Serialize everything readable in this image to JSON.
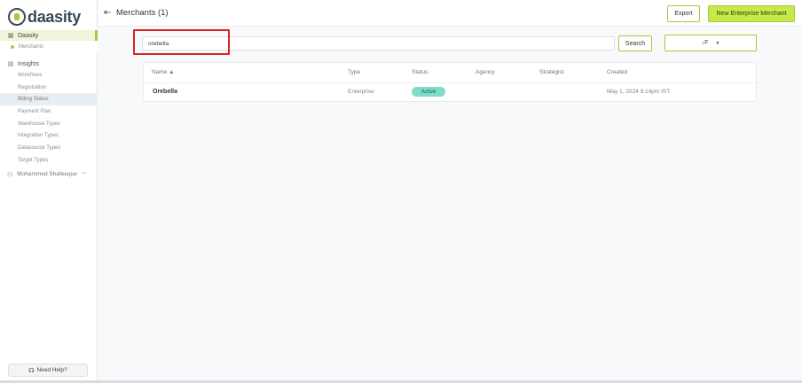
{
  "app": {
    "logo_text": "daasity"
  },
  "sidebar": {
    "daasity_group": {
      "label": "Daasity",
      "items": [
        {
          "label": "Merchants"
        }
      ]
    },
    "insights_group": {
      "label": "Insights",
      "items": [
        {
          "label": "Workflows"
        },
        {
          "label": "Registration"
        },
        {
          "label": "Billing Status"
        },
        {
          "label": "Payment Plan"
        },
        {
          "label": "Warehouse Types"
        },
        {
          "label": "Integration Types"
        },
        {
          "label": "Datasource Types"
        },
        {
          "label": "Target Types"
        }
      ]
    },
    "user": {
      "name": "Mohammed Shafeeque"
    },
    "help_label": "Need Help?"
  },
  "header": {
    "title": "Merchants (1)",
    "export_label": "Export",
    "new_merchant_label": "New Enterprise Merchant"
  },
  "search": {
    "value": "orebella",
    "button_label": "Search",
    "sort_icon_label": "↓F"
  },
  "table": {
    "columns": [
      "Name ▲",
      "Type",
      "Status",
      "Agency",
      "Strategist",
      "Created"
    ],
    "rows": [
      {
        "name": "Orebella",
        "type": "Enterprise",
        "status": "Active",
        "agency": "",
        "strategist": "",
        "created": "May 1, 2024 9:14pm IST"
      }
    ]
  },
  "colors": {
    "accent": "#c6ea4a",
    "accent_border": "#a9c93a",
    "status_active": "#7fdcc9",
    "highlight_box": "#dd2222"
  }
}
